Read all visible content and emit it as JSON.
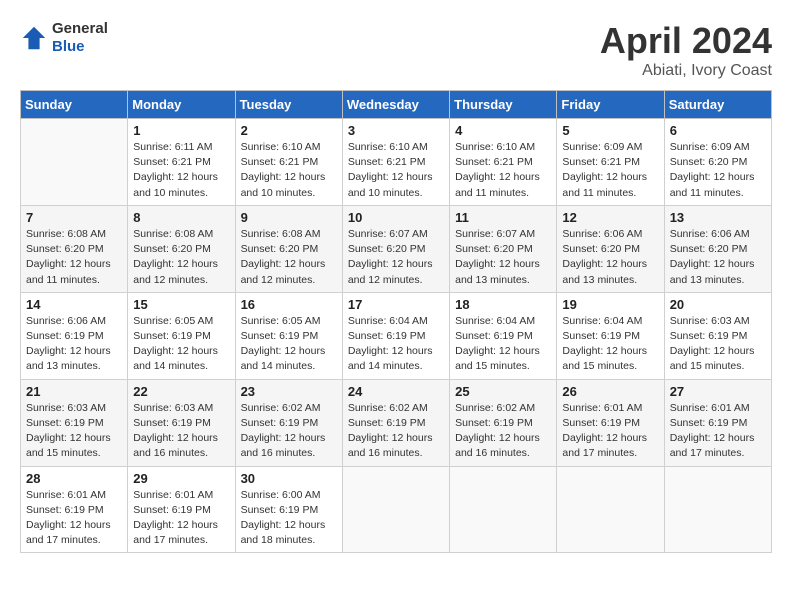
{
  "logo": {
    "general": "General",
    "blue": "Blue"
  },
  "header": {
    "title": "April 2024",
    "subtitle": "Abiati, Ivory Coast"
  },
  "days_of_week": [
    "Sunday",
    "Monday",
    "Tuesday",
    "Wednesday",
    "Thursday",
    "Friday",
    "Saturday"
  ],
  "weeks": [
    [
      {
        "day": "",
        "sunrise": "",
        "sunset": "",
        "daylight": ""
      },
      {
        "day": "1",
        "sunrise": "Sunrise: 6:11 AM",
        "sunset": "Sunset: 6:21 PM",
        "daylight": "Daylight: 12 hours and 10 minutes."
      },
      {
        "day": "2",
        "sunrise": "Sunrise: 6:10 AM",
        "sunset": "Sunset: 6:21 PM",
        "daylight": "Daylight: 12 hours and 10 minutes."
      },
      {
        "day": "3",
        "sunrise": "Sunrise: 6:10 AM",
        "sunset": "Sunset: 6:21 PM",
        "daylight": "Daylight: 12 hours and 10 minutes."
      },
      {
        "day": "4",
        "sunrise": "Sunrise: 6:10 AM",
        "sunset": "Sunset: 6:21 PM",
        "daylight": "Daylight: 12 hours and 11 minutes."
      },
      {
        "day": "5",
        "sunrise": "Sunrise: 6:09 AM",
        "sunset": "Sunset: 6:21 PM",
        "daylight": "Daylight: 12 hours and 11 minutes."
      },
      {
        "day": "6",
        "sunrise": "Sunrise: 6:09 AM",
        "sunset": "Sunset: 6:20 PM",
        "daylight": "Daylight: 12 hours and 11 minutes."
      }
    ],
    [
      {
        "day": "7",
        "sunrise": "Sunrise: 6:08 AM",
        "sunset": "Sunset: 6:20 PM",
        "daylight": "Daylight: 12 hours and 11 minutes."
      },
      {
        "day": "8",
        "sunrise": "Sunrise: 6:08 AM",
        "sunset": "Sunset: 6:20 PM",
        "daylight": "Daylight: 12 hours and 12 minutes."
      },
      {
        "day": "9",
        "sunrise": "Sunrise: 6:08 AM",
        "sunset": "Sunset: 6:20 PM",
        "daylight": "Daylight: 12 hours and 12 minutes."
      },
      {
        "day": "10",
        "sunrise": "Sunrise: 6:07 AM",
        "sunset": "Sunset: 6:20 PM",
        "daylight": "Daylight: 12 hours and 12 minutes."
      },
      {
        "day": "11",
        "sunrise": "Sunrise: 6:07 AM",
        "sunset": "Sunset: 6:20 PM",
        "daylight": "Daylight: 12 hours and 13 minutes."
      },
      {
        "day": "12",
        "sunrise": "Sunrise: 6:06 AM",
        "sunset": "Sunset: 6:20 PM",
        "daylight": "Daylight: 12 hours and 13 minutes."
      },
      {
        "day": "13",
        "sunrise": "Sunrise: 6:06 AM",
        "sunset": "Sunset: 6:20 PM",
        "daylight": "Daylight: 12 hours and 13 minutes."
      }
    ],
    [
      {
        "day": "14",
        "sunrise": "Sunrise: 6:06 AM",
        "sunset": "Sunset: 6:19 PM",
        "daylight": "Daylight: 12 hours and 13 minutes."
      },
      {
        "day": "15",
        "sunrise": "Sunrise: 6:05 AM",
        "sunset": "Sunset: 6:19 PM",
        "daylight": "Daylight: 12 hours and 14 minutes."
      },
      {
        "day": "16",
        "sunrise": "Sunrise: 6:05 AM",
        "sunset": "Sunset: 6:19 PM",
        "daylight": "Daylight: 12 hours and 14 minutes."
      },
      {
        "day": "17",
        "sunrise": "Sunrise: 6:04 AM",
        "sunset": "Sunset: 6:19 PM",
        "daylight": "Daylight: 12 hours and 14 minutes."
      },
      {
        "day": "18",
        "sunrise": "Sunrise: 6:04 AM",
        "sunset": "Sunset: 6:19 PM",
        "daylight": "Daylight: 12 hours and 15 minutes."
      },
      {
        "day": "19",
        "sunrise": "Sunrise: 6:04 AM",
        "sunset": "Sunset: 6:19 PM",
        "daylight": "Daylight: 12 hours and 15 minutes."
      },
      {
        "day": "20",
        "sunrise": "Sunrise: 6:03 AM",
        "sunset": "Sunset: 6:19 PM",
        "daylight": "Daylight: 12 hours and 15 minutes."
      }
    ],
    [
      {
        "day": "21",
        "sunrise": "Sunrise: 6:03 AM",
        "sunset": "Sunset: 6:19 PM",
        "daylight": "Daylight: 12 hours and 15 minutes."
      },
      {
        "day": "22",
        "sunrise": "Sunrise: 6:03 AM",
        "sunset": "Sunset: 6:19 PM",
        "daylight": "Daylight: 12 hours and 16 minutes."
      },
      {
        "day": "23",
        "sunrise": "Sunrise: 6:02 AM",
        "sunset": "Sunset: 6:19 PM",
        "daylight": "Daylight: 12 hours and 16 minutes."
      },
      {
        "day": "24",
        "sunrise": "Sunrise: 6:02 AM",
        "sunset": "Sunset: 6:19 PM",
        "daylight": "Daylight: 12 hours and 16 minutes."
      },
      {
        "day": "25",
        "sunrise": "Sunrise: 6:02 AM",
        "sunset": "Sunset: 6:19 PM",
        "daylight": "Daylight: 12 hours and 16 minutes."
      },
      {
        "day": "26",
        "sunrise": "Sunrise: 6:01 AM",
        "sunset": "Sunset: 6:19 PM",
        "daylight": "Daylight: 12 hours and 17 minutes."
      },
      {
        "day": "27",
        "sunrise": "Sunrise: 6:01 AM",
        "sunset": "Sunset: 6:19 PM",
        "daylight": "Daylight: 12 hours and 17 minutes."
      }
    ],
    [
      {
        "day": "28",
        "sunrise": "Sunrise: 6:01 AM",
        "sunset": "Sunset: 6:19 PM",
        "daylight": "Daylight: 12 hours and 17 minutes."
      },
      {
        "day": "29",
        "sunrise": "Sunrise: 6:01 AM",
        "sunset": "Sunset: 6:19 PM",
        "daylight": "Daylight: 12 hours and 17 minutes."
      },
      {
        "day": "30",
        "sunrise": "Sunrise: 6:00 AM",
        "sunset": "Sunset: 6:19 PM",
        "daylight": "Daylight: 12 hours and 18 minutes."
      },
      {
        "day": "",
        "sunrise": "",
        "sunset": "",
        "daylight": ""
      },
      {
        "day": "",
        "sunrise": "",
        "sunset": "",
        "daylight": ""
      },
      {
        "day": "",
        "sunrise": "",
        "sunset": "",
        "daylight": ""
      },
      {
        "day": "",
        "sunrise": "",
        "sunset": "",
        "daylight": ""
      }
    ]
  ]
}
